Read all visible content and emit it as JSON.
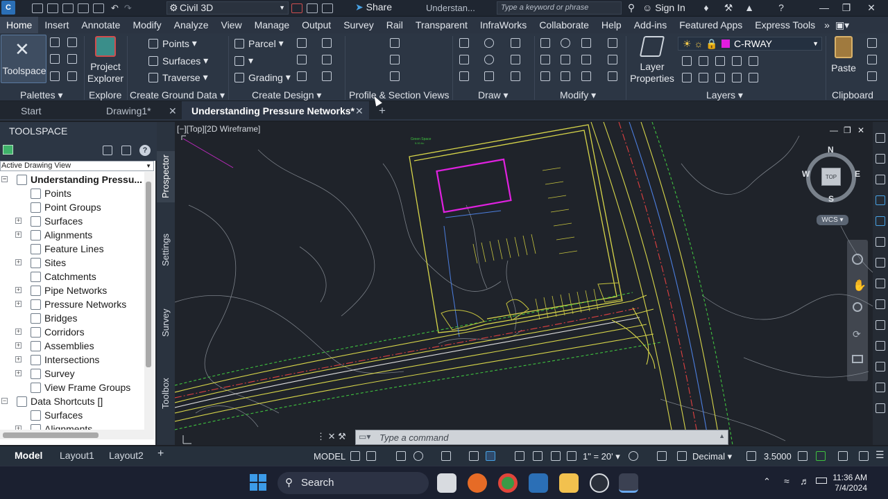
{
  "titlebar": {
    "app_logo": "C",
    "workspace": "Civil 3D",
    "share": "Share",
    "doc_title_short": "Understan...",
    "search_placeholder": "Type a keyword or phrase",
    "sign_in": "Sign In"
  },
  "ribbon_tabs": [
    "Home",
    "Insert",
    "Annotate",
    "Modify",
    "Analyze",
    "View",
    "Manage",
    "Output",
    "Survey",
    "Rail",
    "Transparent",
    "InfraWorks",
    "Collaborate",
    "Help",
    "Add-ins",
    "Featured Apps",
    "Express Tools"
  ],
  "ribbon": {
    "toolspace": "Toolspace",
    "project_explorer": "Project Explorer",
    "points": "Points",
    "surfaces": "Surfaces",
    "traverse": "Traverse",
    "parcel": "Parcel",
    "grading": "Grading",
    "layer_properties": "Layer Properties",
    "current_layer": "C-RWAY",
    "paste": "Paste",
    "panels": {
      "palettes": "Palettes",
      "explore": "Explore",
      "create_ground_data": "Create Ground Data",
      "create_design": "Create Design",
      "profile_section_views": "Profile & Section Views",
      "draw": "Draw",
      "modify": "Modify",
      "layers": "Layers",
      "clipboard": "Clipboard"
    }
  },
  "doc_tabs": {
    "start": "Start",
    "drawing1": "Drawing1*",
    "active": "Understanding Pressure Networks*"
  },
  "toolspace": {
    "title": "TOOLSPACE",
    "view": "Active Drawing View",
    "root": "Understanding Pressu...",
    "items": [
      "Points",
      "Point Groups",
      "Surfaces",
      "Alignments",
      "Feature Lines",
      "Sites",
      "Catchments",
      "Pipe Networks",
      "Pressure Networks",
      "Bridges",
      "Corridors",
      "Assemblies",
      "Intersections",
      "Survey",
      "View Frame Groups"
    ],
    "data_shortcuts": "Data Shortcuts []",
    "ds_items": [
      "Surfaces",
      "Alignments"
    ]
  },
  "side_tabs": [
    "Prospector",
    "Settings",
    "Survey",
    "Toolbox"
  ],
  "viewport": {
    "label": "[−][Top][2D Wireframe]",
    "green_space": "Green Space",
    "green_space_area": "5.00 Ac",
    "cube_top": "TOP",
    "compass": {
      "n": "N",
      "s": "S",
      "e": "E",
      "w": "W"
    },
    "wcs": "WCS",
    "command_placeholder": "Type a command"
  },
  "layout_tabs": [
    "Model",
    "Layout1",
    "Layout2"
  ],
  "status": {
    "model": "MODEL",
    "scale": "1\" = 20'",
    "units": "Decimal",
    "precision": "3.5000"
  },
  "taskbar": {
    "search": "Search",
    "time": "11:36 AM",
    "date": "7/4/2024"
  }
}
